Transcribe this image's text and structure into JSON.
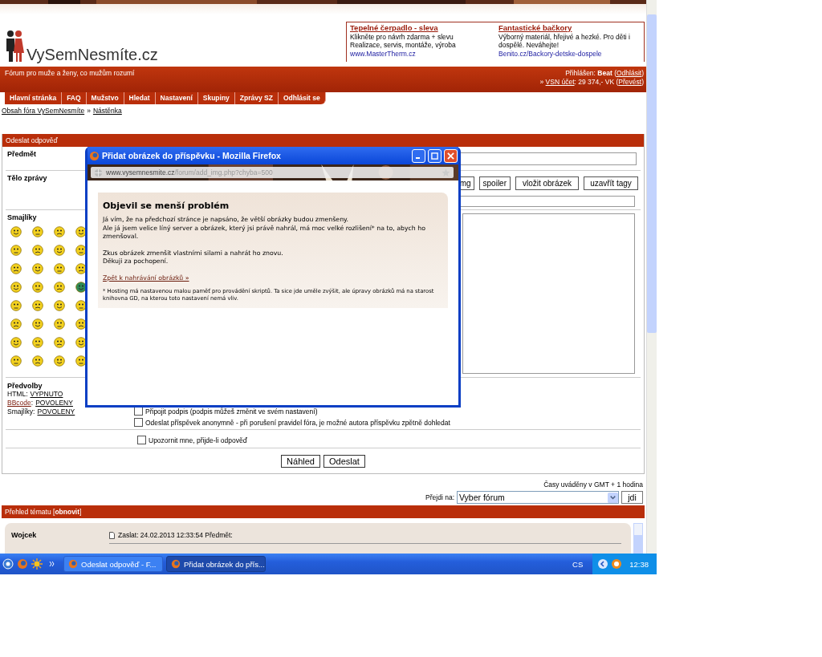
{
  "logo": {
    "text": "VySemNesmíte.cz"
  },
  "ads": [
    {
      "title": "Tepelné čerpadlo - sleva",
      "lines": [
        "Klikněte pro návrh zdarma + slevu",
        "Realizace, servis, montáže, výroba"
      ],
      "url": "www.MasterTherm.cz"
    },
    {
      "title": "Fantastické bačkory",
      "lines": [
        "Výborný materiál, hřejivé a hezké. Pro děti i dospělé. Neváhejte!"
      ],
      "url": "Benito.cz/Backory-detske-dospele"
    }
  ],
  "header": {
    "tagline": "Fórum pro muže a ženy, co mužům rozumí",
    "login": [
      {
        "kind": "text",
        "text": "Přihlášen: "
      },
      {
        "kind": "bold",
        "text": "Beat"
      },
      {
        "kind": "text",
        "text": " ("
      },
      {
        "kind": "link",
        "text": "Odhlásit"
      },
      {
        "kind": "text",
        "text": ")"
      }
    ],
    "account": [
      {
        "kind": "text",
        "text": "» "
      },
      {
        "kind": "link",
        "text": "VSN účet"
      },
      {
        "kind": "text",
        "text": ": 29 374,- VK ("
      },
      {
        "kind": "link",
        "text": "Převést"
      },
      {
        "kind": "text",
        "text": ")"
      }
    ]
  },
  "nav": [
    "Hlavní stránka",
    "FAQ",
    "Mužstvo",
    "Hledat",
    "Nastavení",
    "Skupiny",
    "Zprávy SZ",
    "Odhlásit se"
  ],
  "breadcrumbs": {
    "items": [
      "Obsah fóra VySemNesmíte",
      "Nástěnka"
    ],
    "separator": "»"
  },
  "form": {
    "title": "Odeslat odpověď",
    "subject_label": "Předmět",
    "body_label": "Tělo zprávy",
    "toolbar": [
      "mg",
      "spoiler",
      "vložit obrázek",
      "uzavřít tagy"
    ],
    "smileys_label": "Smajlíky",
    "options_label": "Předvolby",
    "options": [
      {
        "label": "HTML",
        "label_link": false,
        "delimiter": ":",
        "value": "VYPNUTO"
      },
      {
        "label": "BBcode",
        "label_link": true,
        "delimiter": ":",
        "value": "POVOLENY"
      },
      {
        "label": "Smajlíky",
        "label_link": false,
        "delimiter": ":",
        "value": "POVOLENY"
      }
    ],
    "checkboxes": [
      {
        "label": "Připojit podpis (podpis můžeš změnit ve svém nastavení)",
        "checked": false
      },
      {
        "label": "Odeslat příspěvek anonymně - při porušení pravidel fóra, je možné autora příspěvku zpětně dohledat",
        "checked": false
      },
      {
        "label": "Upozornit mne, přijde-li odpověď",
        "checked": false
      }
    ],
    "buttons": [
      "Náhled",
      "Odeslat"
    ]
  },
  "timezone": "Časy uváděny v GMT + 1 hodina",
  "jump": {
    "label": "Přejdi na:",
    "value": "Vyber fórum",
    "button": "jdi"
  },
  "review": {
    "title": "Přehled tématu [**obnovit**]",
    "author": "Wojcek",
    "meta": "Zaslat: 24.02.2013 12:33:54 Předmět:"
  },
  "popup": {
    "title": "Přidat obrázek do příspěvku - Mozilla Firefox",
    "url_host": "www.vysemnesmite.cz",
    "url_path": "/forum/add_img.php?chyba=500",
    "heading": "Objevil se menší problém",
    "paragraphs": [
      [
        "Já vím, že na předchozí stránce je napsáno, že větší obrázky budou zmenšeny.",
        "Ale já jsem velice líný server a obrázek, který jsi právě nahrál, má moc velké rozlišení* na to, abych ho zmenšoval."
      ],
      [
        "Zkus obrázek zmenšit vlastními silami a nahrát ho znovu.",
        "Děkuji za pochopení."
      ]
    ],
    "link": "Zpět k nahrávání obrázků »",
    "footnote": "* Hosting má nastavenou malou paměť pro provádění skriptů. Ta sice jde uměle zvýšit, ale úpravy obrázků má na starost knihovna GD, na kterou toto nastavení nemá vliv."
  },
  "taskbar": {
    "tasks": [
      {
        "label": "Odeslat odpověď - F...",
        "selected": false
      },
      {
        "label": "Přidat obrázek do přís...",
        "selected": true
      }
    ],
    "language": "CS",
    "clock": "12:38"
  }
}
